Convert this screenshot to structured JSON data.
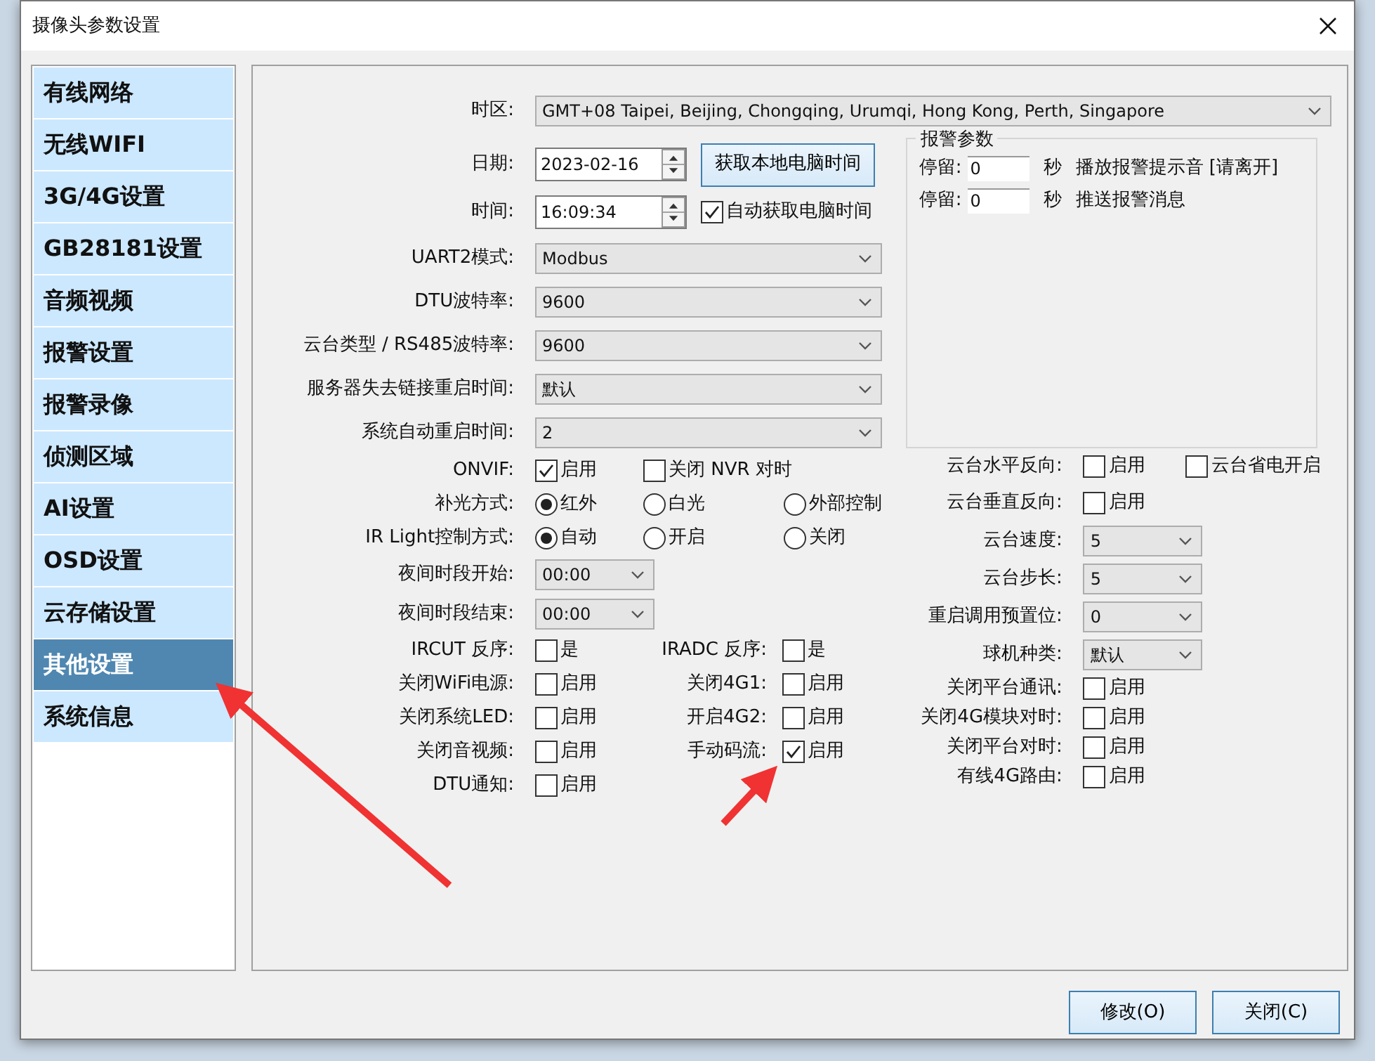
{
  "window": {
    "title": "摄像头参数设置"
  },
  "sidebar": {
    "items": [
      {
        "label": "有线网络",
        "selected": false
      },
      {
        "label": "无线WIFI",
        "selected": false
      },
      {
        "label": "3G/4G设置",
        "selected": false
      },
      {
        "label": "GB28181设置",
        "selected": false
      },
      {
        "label": "音频视频",
        "selected": false
      },
      {
        "label": "报警设置",
        "selected": false
      },
      {
        "label": "报警录像",
        "selected": false
      },
      {
        "label": "侦测区域",
        "selected": false
      },
      {
        "label": "AI设置",
        "selected": false
      },
      {
        "label": "OSD设置",
        "selected": false
      },
      {
        "label": "云存储设置",
        "selected": false
      },
      {
        "label": "其他设置",
        "selected": true
      },
      {
        "label": "系统信息",
        "selected": false
      }
    ]
  },
  "timezone": {
    "label": "时区:",
    "value": "GMT+08 Taipei, Beijing, Chongqing, Urumqi, Hong Kong, Perth, Singapore"
  },
  "date": {
    "label": "日期:",
    "value": "2023-02-16"
  },
  "get_pc_time_button": "获取本地电脑时间",
  "time": {
    "label": "时间:",
    "value": "16:09:34"
  },
  "auto_pc_time": {
    "label": "自动获取电脑时间",
    "checked": true
  },
  "left_rows": [
    {
      "kind": "select",
      "label": "UART2模式:",
      "value": "Modbus"
    },
    {
      "kind": "select",
      "label": "DTU波特率:",
      "value": "9600"
    },
    {
      "kind": "select",
      "label": "云台类型 / RS485波特率:",
      "value": "9600"
    },
    {
      "kind": "select",
      "label": "服务器失去链接重启时间:",
      "value": "默认"
    },
    {
      "kind": "select",
      "label": "系统自动重启时间:",
      "value": "2"
    },
    {
      "kind": "checks",
      "label": "ONVIF:",
      "options": [
        {
          "label": "启用",
          "checked": true
        },
        {
          "label": "关闭 NVR 对时",
          "checked": false
        }
      ]
    },
    {
      "kind": "radios",
      "label": "补光方式:",
      "options": [
        {
          "label": "红外",
          "selected": true
        },
        {
          "label": "白光",
          "selected": false
        },
        {
          "label": "外部控制",
          "selected": false
        }
      ]
    },
    {
      "kind": "radios",
      "label": "IR Light控制方式:",
      "options": [
        {
          "label": "自动",
          "selected": true
        },
        {
          "label": "开启",
          "selected": false
        },
        {
          "label": "关闭",
          "selected": false
        }
      ]
    },
    {
      "kind": "short_select",
      "label": "夜间时段开始:",
      "value": "00:00"
    },
    {
      "kind": "short_select",
      "label": "夜间时段结束:",
      "value": "00:00"
    },
    {
      "kind": "check_pairs",
      "items": [
        {
          "label": "IRCUT 反序:",
          "option": "是",
          "checked": false
        },
        {
          "label": "IRADC 反序:",
          "option": "是",
          "checked": false
        }
      ]
    },
    {
      "kind": "check_pairs",
      "items": [
        {
          "label": "关闭WiFi电源:",
          "option": "启用",
          "checked": false
        },
        {
          "label": "关闭4G1:",
          "option": "启用",
          "checked": false
        }
      ]
    },
    {
      "kind": "check_pairs",
      "items": [
        {
          "label": "关闭系统LED:",
          "option": "启用",
          "checked": false
        },
        {
          "label": "开启4G2:",
          "option": "启用",
          "checked": false
        }
      ]
    },
    {
      "kind": "check_pairs",
      "items": [
        {
          "label": "关闭音视频:",
          "option": "启用",
          "checked": false
        },
        {
          "label": "手动码流:",
          "option": "启用",
          "checked": true
        }
      ]
    },
    {
      "kind": "check_pairs",
      "items": [
        {
          "label": "DTU通知:",
          "option": "启用",
          "checked": false
        }
      ]
    }
  ],
  "alarm_group": {
    "title": "报警参数",
    "rows": [
      {
        "label": "停留:",
        "value": "0",
        "unit": "秒",
        "action": "播放报警提示音 [请离开]"
      },
      {
        "label": "停留:",
        "value": "0",
        "unit": "秒",
        "action": "推送报警消息"
      }
    ]
  },
  "right_rows": [
    {
      "kind": "checks",
      "label": "云台水平反向:",
      "options": [
        {
          "label": "启用",
          "checked": false
        },
        {
          "label": "云台省电开启",
          "checked": false
        }
      ]
    },
    {
      "kind": "checks",
      "label": "云台垂直反向:",
      "options": [
        {
          "label": "启用",
          "checked": false
        }
      ]
    },
    {
      "kind": "select",
      "label": "云台速度:",
      "value": "5"
    },
    {
      "kind": "select",
      "label": "云台步长:",
      "value": "5"
    },
    {
      "kind": "select",
      "label": "重启调用预置位:",
      "value": "0"
    },
    {
      "kind": "select",
      "label": "球机种类:",
      "value": "默认"
    },
    {
      "kind": "small_checks",
      "label": "关闭平台通讯:",
      "options": [
        {
          "label": "启用",
          "checked": false
        }
      ]
    },
    {
      "kind": "small_checks",
      "label": "关闭4G模块对时:",
      "options": [
        {
          "label": "启用",
          "checked": false
        }
      ]
    },
    {
      "kind": "small_checks",
      "label": "关闭平台对时:",
      "options": [
        {
          "label": "启用",
          "checked": false
        }
      ]
    },
    {
      "kind": "small_checks",
      "label": "有线4G路由:",
      "options": [
        {
          "label": "启用",
          "checked": false
        }
      ]
    }
  ],
  "buttons": [
    "修改(O)",
    "关闭(C)"
  ]
}
